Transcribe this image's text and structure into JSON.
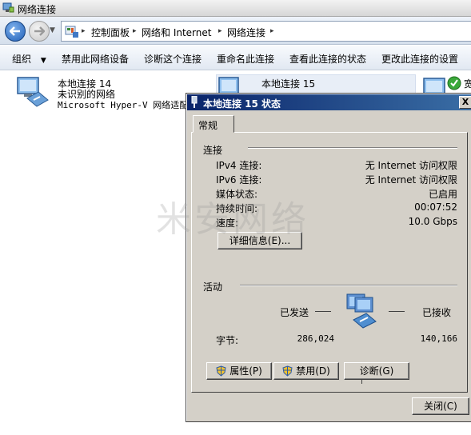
{
  "window": {
    "title": "网络连接"
  },
  "address": {
    "crumbs": [
      "控制面板",
      "网络和 Internet",
      "网络连接"
    ]
  },
  "commands": [
    "组织",
    "禁用此网络设备",
    "诊断这个连接",
    "重命名此连接",
    "查看此连接的状态",
    "更改此连接的设置"
  ],
  "connections": [
    {
      "name": "本地连接 14",
      "status": "未识别的网络",
      "adapter": "Microsoft Hyper-V 网络适配"
    },
    {
      "name": "本地连接 15"
    },
    {
      "name": "宽"
    }
  ],
  "dialog": {
    "title": "本地连接 15 状态",
    "close_glyph": "X",
    "tab": "常规",
    "connection_section": "连接",
    "rows": [
      {
        "label": "IPv4 连接:",
        "value": "无 Internet 访问权限"
      },
      {
        "label": "IPv6 连接:",
        "value": "无 Internet 访问权限"
      },
      {
        "label": "媒体状态:",
        "value": "已启用"
      },
      {
        "label": "持续时间:",
        "value": "00:07:52"
      },
      {
        "label": "速度:",
        "value": "10.0 Gbps"
      }
    ],
    "details_button": "详细信息(E)...",
    "activity_section": "活动",
    "sent_label": "已发送",
    "received_label": "已接收",
    "bytes_label": "字节:",
    "bytes_sent": "286,024",
    "bytes_received": "140,166",
    "properties_button": "属性(P)",
    "disable_button": "禁用(D)",
    "diagnose_button": "诊断(G)",
    "close_button": "关闭(C)"
  },
  "watermark": "米安网络",
  "colors": {
    "dialog_face": "#d4d0c8",
    "title_gradient_start": "#0a246a",
    "title_gradient_end": "#3a6ea5",
    "selection": "#e8eef7"
  }
}
